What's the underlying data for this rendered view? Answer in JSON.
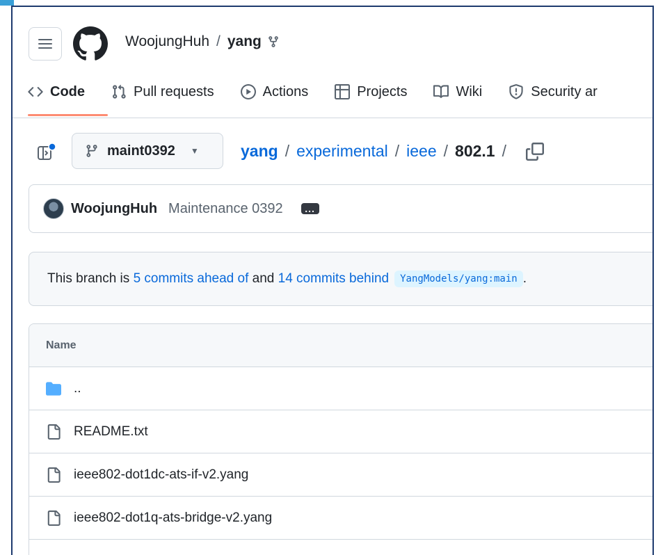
{
  "header": {
    "owner": "WoojungHuh",
    "separator": "/",
    "repo": "yang"
  },
  "tabs": [
    {
      "label": "Code",
      "icon": "code-icon",
      "active": true
    },
    {
      "label": "Pull requests",
      "icon": "pull-request-icon",
      "active": false
    },
    {
      "label": "Actions",
      "icon": "play-icon",
      "active": false
    },
    {
      "label": "Projects",
      "icon": "table-icon",
      "active": false
    },
    {
      "label": "Wiki",
      "icon": "book-icon",
      "active": false
    },
    {
      "label": "Security ar",
      "icon": "shield-icon",
      "active": false
    }
  ],
  "branch": {
    "name": "maint0392"
  },
  "breadcrumb": {
    "repo": "yang",
    "sep": "/",
    "part1": "experimental",
    "part2": "ieee",
    "current": "802.1",
    "trailing": "/"
  },
  "commit": {
    "author": "WoojungHuh",
    "message": "Maintenance 0392",
    "ellipsis": "..."
  },
  "status": {
    "prefix": "This branch is",
    "ahead": "5 commits ahead of",
    "middle": "and",
    "behind": "14 commits behind",
    "upstream": "YangModels/yang:main",
    "suffix": "."
  },
  "table": {
    "header": "Name",
    "rows": [
      {
        "name": "..",
        "type": "folder"
      },
      {
        "name": "README.txt",
        "type": "file"
      },
      {
        "name": "ieee802-dot1dc-ats-if-v2.yang",
        "type": "file"
      },
      {
        "name": "ieee802-dot1q-ats-bridge-v2.yang",
        "type": "file"
      }
    ]
  },
  "colors": {
    "link": "#0969da",
    "accent_underline": "#fd8c73",
    "folder": "#54aeff",
    "frame_border": "#1d3a6e",
    "title_accent": "#3aa0d8"
  }
}
